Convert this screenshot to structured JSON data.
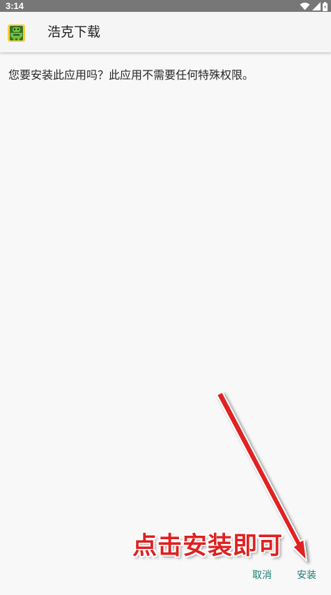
{
  "status_bar": {
    "time": "3:14",
    "icons": [
      "wifi-icon",
      "cell-signal-icon",
      "battery-icon"
    ]
  },
  "app_bar": {
    "title": "浩克下载",
    "icon": "android-app-icon"
  },
  "content": {
    "message": "您要安装此应用吗？此应用不需要任何特殊权限。"
  },
  "buttons": {
    "cancel": "取消",
    "install": "安装"
  },
  "annotation": {
    "text": "点击安装即可",
    "color": "#e02020"
  },
  "colors": {
    "status_bar": "#777777",
    "accent": "#1b7d75",
    "background": "#f8f8f8"
  }
}
